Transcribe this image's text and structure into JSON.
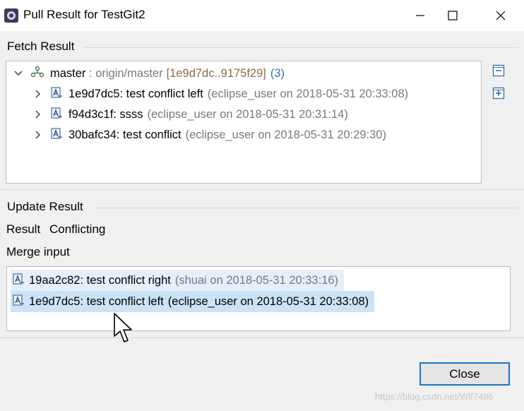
{
  "window": {
    "title": "Pull Result for TestGit2",
    "minimize_icon": "minimize-icon",
    "maximize_icon": "maximize-icon",
    "close_icon": "close-icon"
  },
  "fetch_result": {
    "label": "Fetch Result",
    "branch": {
      "name": "master",
      "separator": " : ",
      "remote": "origin/master",
      "range": "[1e9d7dc..9175f29]",
      "count": "(3)"
    },
    "commits": [
      {
        "id_message": "1e9d7dc5: test conflict left",
        "meta": "(eclipse_user on 2018-05-31 20:33:08)"
      },
      {
        "id_message": "f94d3c1f: ssss",
        "meta": "(eclipse_user on 2018-05-31 20:31:14)"
      },
      {
        "id_message": "30bafc34: test conflict",
        "meta": "(eclipse_user on 2018-05-31 20:29:30)"
      }
    ]
  },
  "update_result": {
    "label": "Update Result",
    "result_label": "Result",
    "result_value": "Conflicting",
    "merge_input_label": "Merge input",
    "merge_inputs": [
      {
        "id_message": "19aa2c82: test conflict right",
        "meta": "(shuai on 2018-05-31 20:33:16)"
      },
      {
        "id_message": "1e9d7dc5: test conflict left",
        "meta": "(eclipse_user on 2018-05-31 20:33:08)"
      }
    ]
  },
  "buttons": {
    "close": "Close"
  },
  "watermark": "https://blog.csdn.net/Wlf7496"
}
